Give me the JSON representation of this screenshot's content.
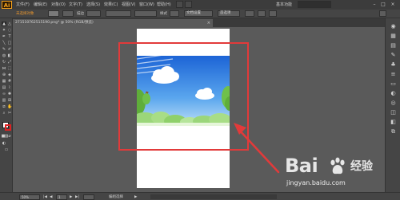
{
  "app": {
    "logo": "Ai"
  },
  "menu": {
    "items": [
      "文件(F)",
      "编辑(E)",
      "对象(O)",
      "文字(T)",
      "选择(S)",
      "效果(C)",
      "视图(V)",
      "窗口(W)",
      "帮助(H)"
    ],
    "essentials": "基本功能",
    "search_placeholder": ""
  },
  "control_bar": {
    "selection": "未选择对象",
    "stroke_label": "描边",
    "style_label": "样式",
    "doc_setup": "文档设置",
    "preferences": "首选项"
  },
  "document_tab": {
    "title": "271510762515190.png* @ 50% (RGB/预览)",
    "close": "×"
  },
  "status_bar": {
    "zoom": "50%",
    "page": "1",
    "tool_name": "编组选择"
  },
  "watermark": {
    "brand": "Bai",
    "cn": "经验",
    "url": "jingyan.baidu.com"
  },
  "colors": {
    "annotation": "#e23a3a",
    "sky_top": "#1c64d6",
    "sky_bottom": "#bfe0f7",
    "grass": "#8fd06a"
  }
}
